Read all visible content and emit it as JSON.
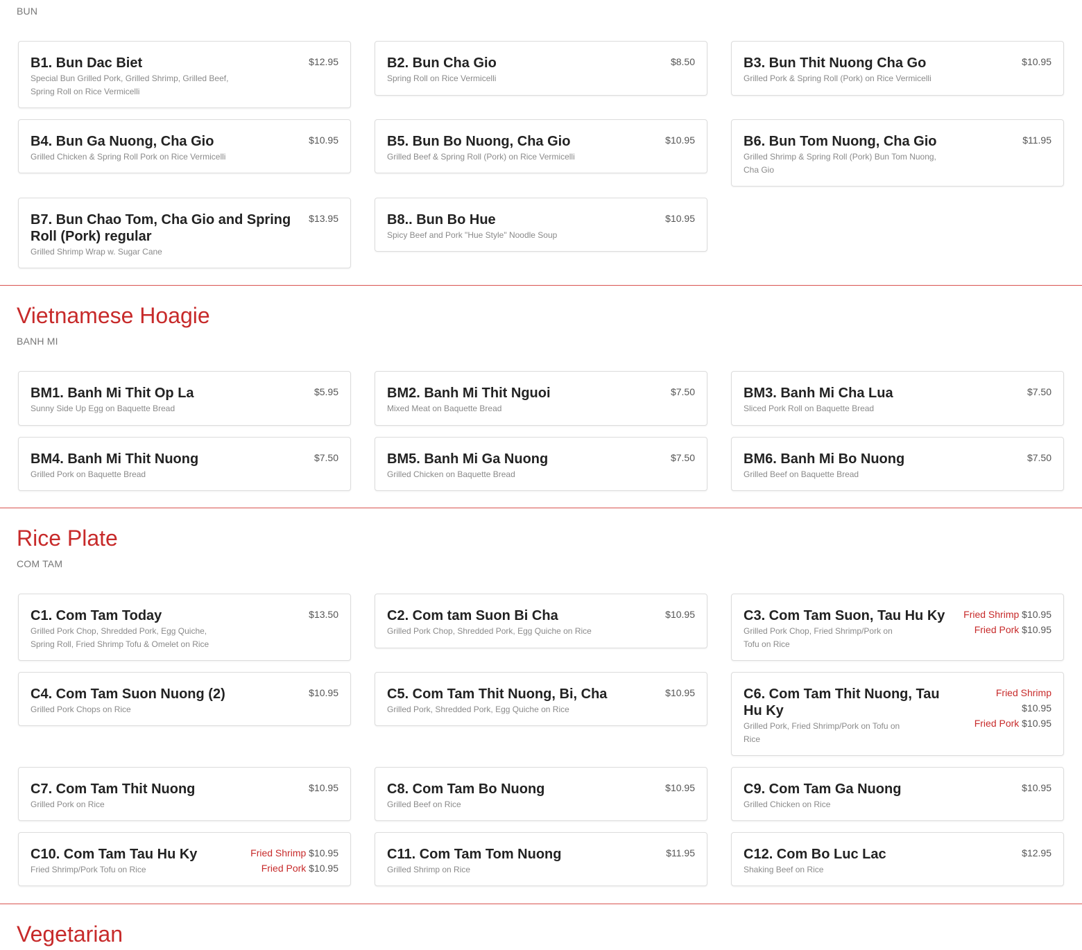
{
  "theme": {
    "accent": "#c72a2a",
    "divider": "#d9534f"
  },
  "bun": {
    "subtitle": "BUN",
    "items": [
      {
        "name": "B1. Bun Dac Biet",
        "desc": "Special Bun Grilled Pork, Grilled Shrimp, Grilled Beef, Spring Roll on Rice Vermicelli",
        "price": "$12.95"
      },
      {
        "name": "B2. Bun Cha Gio",
        "desc": "Spring Roll on Rice Vermicelli",
        "price": "$8.50"
      },
      {
        "name": "B3. Bun Thit Nuong Cha Go",
        "desc": "Grilled Pork & Spring Roll (Pork) on Rice Vermicelli",
        "price": "$10.95"
      },
      {
        "name": "B4. Bun Ga Nuong, Cha Gio",
        "desc": "Grilled Chicken & Spring Roll Pork on Rice Vermicelli",
        "price": "$10.95"
      },
      {
        "name": "B5. Bun Bo Nuong, Cha Gio",
        "desc": "Grilled Beef & Spring Roll (Pork) on Rice Vermicelli",
        "price": "$10.95"
      },
      {
        "name": "B6. Bun Tom Nuong, Cha Gio",
        "desc": "Grilled Shrimp & Spring Roll (Pork) Bun Tom Nuong, Cha Gio",
        "price": "$11.95"
      },
      {
        "name": "B7. Bun Chao Tom, Cha Gio and Spring Roll (Pork) regular",
        "desc": "Grilled Shrimp Wrap w. Sugar Cane",
        "price": "$13.95"
      },
      {
        "name": "B8.. Bun Bo Hue",
        "desc": "Spicy Beef and Pork \"Hue Style\" Noodle Soup",
        "price": "$10.95"
      }
    ]
  },
  "hoagie": {
    "title": "Vietnamese Hoagie",
    "subtitle": "BANH MI",
    "items": [
      {
        "name": "BM1. Banh Mi Thit Op La",
        "desc": "Sunny Side Up Egg on Baquette Bread",
        "price": "$5.95"
      },
      {
        "name": "BM2. Banh Mi Thit Nguoi",
        "desc": "Mixed Meat on Baquette Bread",
        "price": "$7.50"
      },
      {
        "name": "BM3. Banh Mi Cha Lua",
        "desc": "Sliced Pork Roll on Baquette Bread",
        "price": "$7.50"
      },
      {
        "name": "BM4. Banh Mi Thit Nuong",
        "desc": "Grilled Pork on Baquette Bread",
        "price": "$7.50"
      },
      {
        "name": "BM5. Banh Mi Ga Nuong",
        "desc": "Grilled Chicken on Baquette Bread",
        "price": "$7.50"
      },
      {
        "name": "BM6. Banh Mi Bo Nuong",
        "desc": "Grilled Beef on Baquette Bread",
        "price": "$7.50"
      }
    ]
  },
  "rice": {
    "title": "Rice Plate",
    "subtitle": "COM TAM",
    "items": [
      {
        "name": "C1. Com Tam Today",
        "desc": "Grilled Pork Chop, Shredded Pork, Egg Quiche, Spring Roll, Fried Shrimp Tofu & Omelet on Rice",
        "price": "$13.50"
      },
      {
        "name": "C2. Com tam Suon Bi Cha",
        "desc": "Grilled Pork Chop, Shredded Pork, Egg Quiche on Rice",
        "price": "$10.95"
      },
      {
        "name": "C3. Com Tam Suon, Tau Hu Ky",
        "desc": "Grilled Pork Chop, Fried Shrimp/Pork on Tofu on Rice",
        "options": [
          {
            "label": "Fried Shrimp",
            "price": "$10.95"
          },
          {
            "label": "Fried Pork",
            "price": "$10.95"
          }
        ]
      },
      {
        "name": "C4. Com Tam Suon Nuong (2)",
        "desc": "Grilled Pork Chops on Rice",
        "price": "$10.95"
      },
      {
        "name": "C5. Com Tam Thit Nuong, Bi, Cha",
        "desc": "Grilled Pork, Shredded Pork, Egg Quiche on Rice",
        "price": "$10.95"
      },
      {
        "name": "C6. Com Tam Thit Nuong, Tau Hu Ky",
        "desc": "Grilled Pork, Fried Shrimp/Pork on Tofu on Rice",
        "options": [
          {
            "label": "Fried Shrimp",
            "price": "$10.95"
          },
          {
            "label": "Fried Pork",
            "price": "$10.95"
          }
        ]
      },
      {
        "name": "C7. Com Tam Thit Nuong",
        "desc": "Grilled Pork on Rice",
        "price": "$10.95"
      },
      {
        "name": "C8. Com Tam Bo Nuong",
        "desc": "Grilled Beef on Rice",
        "price": "$10.95"
      },
      {
        "name": "C9. Com Tam Ga Nuong",
        "desc": "Grilled Chicken on Rice",
        "price": "$10.95"
      },
      {
        "name": "C10. Com Tam Tau Hu Ky",
        "desc": "Fried Shrimp/Pork Tofu on Rice",
        "options": [
          {
            "label": "Fried Shrimp",
            "price": "$10.95"
          },
          {
            "label": "Fried Pork",
            "price": "$10.95"
          }
        ]
      },
      {
        "name": "C11. Com Tam Tom Nuong",
        "desc": "Grilled Shrimp on Rice",
        "price": "$11.95"
      },
      {
        "name": "C12. Com Bo Luc Lac",
        "desc": "Shaking Beef on Rice",
        "price": "$12.95"
      }
    ]
  },
  "vegetarian": {
    "title": "Vegetarian"
  }
}
